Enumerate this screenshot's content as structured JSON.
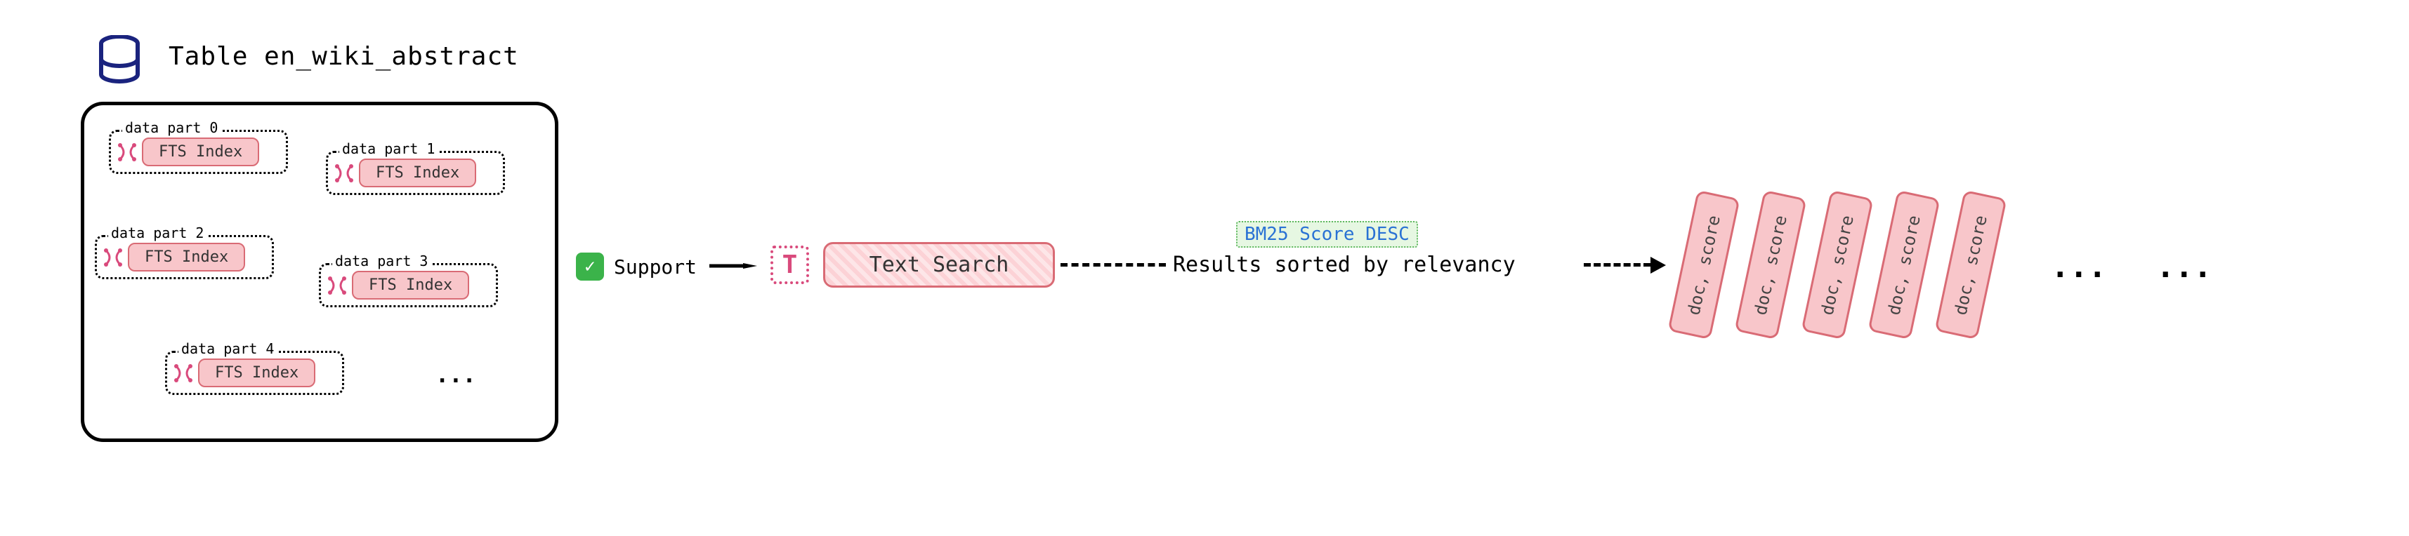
{
  "table": {
    "title": "Table en_wiki_abstract",
    "parts": [
      "data part 0",
      "data part 1",
      "data part 2",
      "data part 3",
      "data part 4"
    ],
    "index_label": "FTS Index",
    "ellipsis": "..."
  },
  "support": {
    "label": "Support"
  },
  "search": {
    "icon_letter": "T",
    "label": "Text Search"
  },
  "results": {
    "score_label": "BM25 Score DESC",
    "sorted_label": "Results sorted by relevancy",
    "card_label": "doc, score",
    "ellipsis": "..."
  }
}
